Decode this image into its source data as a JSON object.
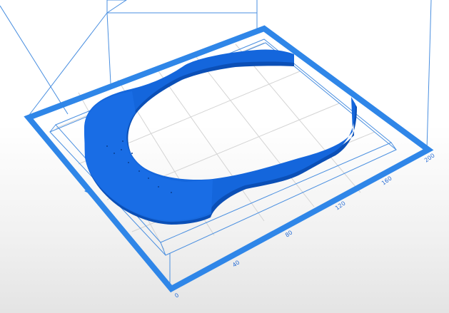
{
  "viewport": {
    "axis_ticks": [
      "0",
      "40",
      "80",
      "120",
      "160",
      "200"
    ]
  },
  "colors": {
    "frame": "#2f86e8",
    "wire": "#4a8fe0",
    "grid": "#d4d4d4",
    "model": "#1466dc",
    "model_dark": "#0b4fb6"
  }
}
